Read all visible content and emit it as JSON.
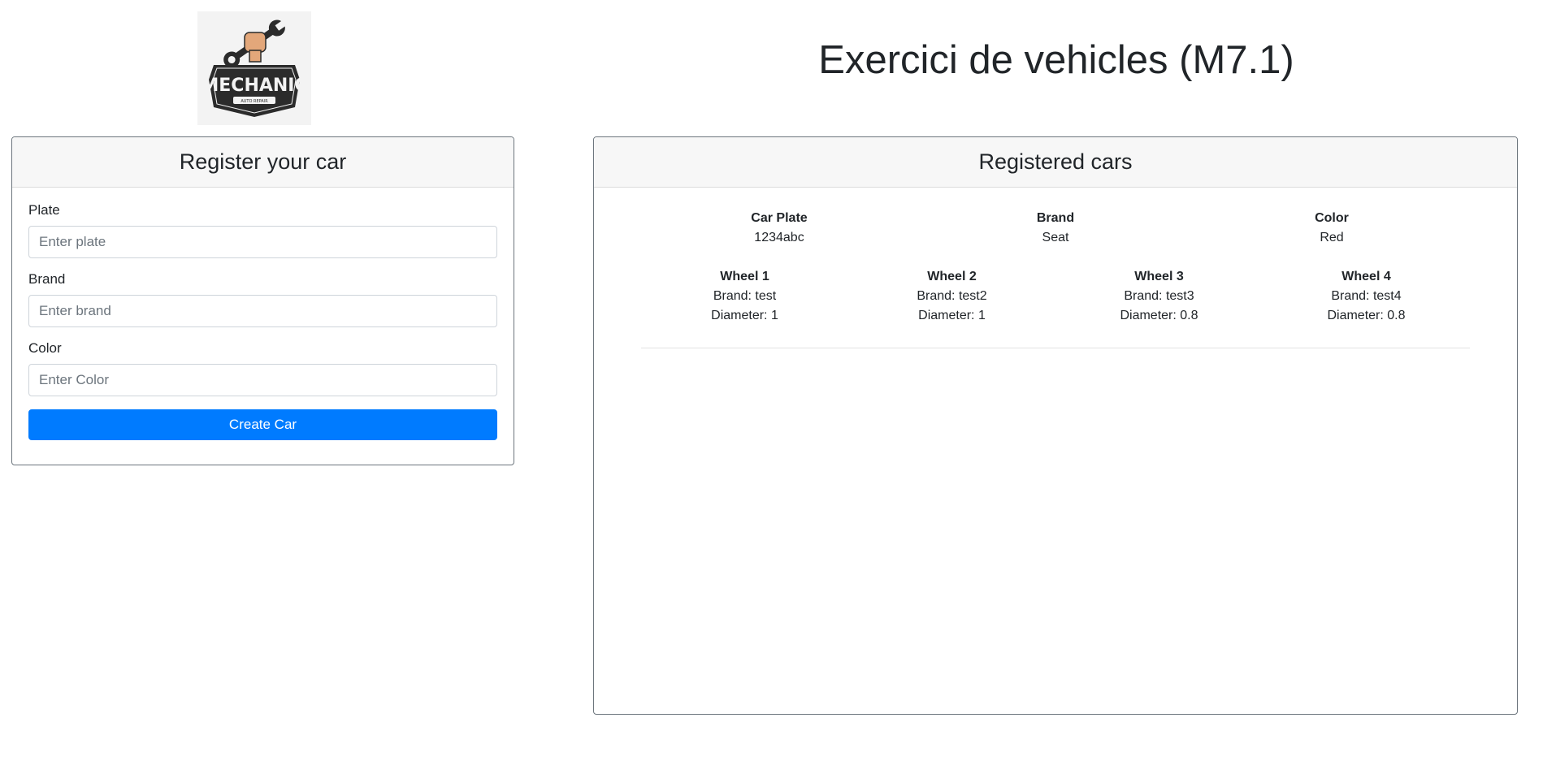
{
  "header": {
    "title": "Exercici de vehicles (M7.1)",
    "logo_text": "MECHANIC",
    "logo_subtext": "AUTO REPAIR"
  },
  "register": {
    "title": "Register your car",
    "fields": [
      {
        "label": "Plate",
        "placeholder": "Enter plate",
        "value": ""
      },
      {
        "label": "Brand",
        "placeholder": "Enter brand",
        "value": ""
      },
      {
        "label": "Color",
        "placeholder": "Enter Color",
        "value": ""
      }
    ],
    "submit_label": "Create Car"
  },
  "registered": {
    "title": "Registered cars",
    "column_labels": {
      "plate": "Car Plate",
      "brand": "Brand",
      "color": "Color"
    },
    "cars": [
      {
        "plate": "1234abc",
        "brand": "Seat",
        "color": "Red",
        "wheels": [
          {
            "title": "Wheel 1",
            "brand": "Brand: test",
            "diameter": "Diameter: 1"
          },
          {
            "title": "Wheel 2",
            "brand": "Brand: test2",
            "diameter": "Diameter: 1"
          },
          {
            "title": "Wheel 3",
            "brand": "Brand: test3",
            "diameter": "Diameter: 0.8"
          },
          {
            "title": "Wheel 4",
            "brand": "Brand: test4",
            "diameter": "Diameter: 0.8"
          }
        ]
      }
    ]
  },
  "colors": {
    "primary": "#007bff",
    "card_header_bg": "#f7f7f7",
    "card_border": "#6c757d",
    "text": "#212529"
  }
}
